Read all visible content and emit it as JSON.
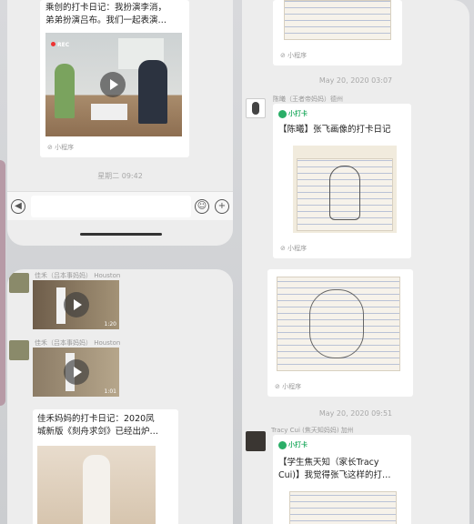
{
  "left_top": {
    "card_text_line1": "乘创的打卡日记：我扮演李消，",
    "card_text_line2": "弟弟扮演吕布。我们一起表演…",
    "rec_label": "REC",
    "mini_program_tag": "小程序",
    "timestamp": "星期二 09:42"
  },
  "left_bottom": {
    "msgs": [
      {
        "sender": "佳禾（吕本事妈妈） Houston",
        "duration": "1:20"
      },
      {
        "sender": "佳禾（吕本事妈妈） Houston",
        "duration": "1:01"
      }
    ],
    "card_title_line1": "佳禾妈妈的打卡日记：2020凤",
    "card_title_line2": "城新版《刻舟求剑》已经出炉…"
  },
  "right": {
    "mini_program_tag_top": "小程序",
    "timestamp1": "May 20, 2020 03:07",
    "sender1": "陈曦（王者帝妈妈）德州",
    "mp_name": "小打卡",
    "card1_title": "【陈曦】张飞画像的打卡日记",
    "mini_program_tag1": "小程序",
    "mini_program_tag2": "小程序",
    "timestamp2": "May 20, 2020 09:51",
    "sender2": "Tracy Cui (焦天知妈妈) 加州",
    "card2_title_line1": "【学生焦天知（家长Tracy",
    "card2_title_line2": "Cui)】我觉得张飞这样的打…"
  },
  "colors": {
    "accent": "#2aae67",
    "chat_bg": "#ededed"
  }
}
